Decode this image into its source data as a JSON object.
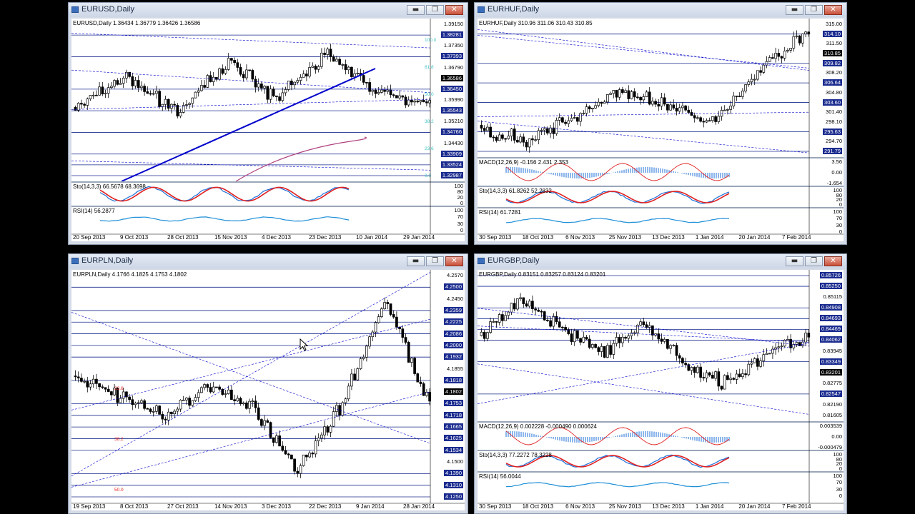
{
  "windows": [
    {
      "id": "w1",
      "title": "EURUSD,Daily",
      "info": "EURUSD,Daily  1.36434 1.36779 1.36426 1.36586",
      "prices": [
        {
          "v": "1.39150",
          "s": "plain"
        },
        {
          "v": "1.38281",
          "s": "box"
        },
        {
          "v": "1.37350",
          "s": "plain"
        },
        {
          "v": "1.37393",
          "s": "box"
        },
        {
          "v": "1.36790",
          "s": "plain"
        },
        {
          "v": "1.36586",
          "s": "cur"
        },
        {
          "v": "1.36450",
          "s": "box"
        },
        {
          "v": "1.35990",
          "s": "plain"
        },
        {
          "v": "1.35543",
          "s": "box"
        },
        {
          "v": "1.35210",
          "s": "plain"
        },
        {
          "v": "1.34766",
          "s": "box"
        },
        {
          "v": "1.34430",
          "s": "plain"
        },
        {
          "v": "1.33909",
          "s": "box"
        },
        {
          "v": "1.33524",
          "s": "box"
        },
        {
          "v": "1.32987",
          "s": "box"
        }
      ],
      "indicators": [
        {
          "label": "Sto(14,3,3) 66.5678 68.3698",
          "scale": [
            "100",
            "80",
            "20",
            "0"
          ]
        },
        {
          "label": "RSI(14) 56.2877",
          "scale": [
            "100",
            "70",
            "30",
            "0"
          ]
        }
      ],
      "dates": [
        "20 Sep 2013",
        "9 Oct 2013",
        "28 Oct 2013",
        "15 Nov 2013",
        "4 Dec 2013",
        "23 Dec 2013",
        "10 Jan 2014",
        "29 Jan 2014"
      ],
      "fibo": [
        "100.0",
        "61.8",
        "50.0",
        "38.2",
        "23.6",
        "0.0"
      ]
    },
    {
      "id": "w2",
      "title": "EURHUF,Daily",
      "info": "EURHUF,Daily  310.96 311.06 310.43 310.85",
      "prices": [
        {
          "v": "315.00",
          "s": "plain"
        },
        {
          "v": "314.10",
          "s": "box"
        },
        {
          "v": "311.50",
          "s": "plain"
        },
        {
          "v": "310.85",
          "s": "cur"
        },
        {
          "v": "309.82",
          "s": "box"
        },
        {
          "v": "308.20",
          "s": "plain"
        },
        {
          "v": "306.64",
          "s": "box"
        },
        {
          "v": "304.80",
          "s": "plain"
        },
        {
          "v": "303.60",
          "s": "box"
        },
        {
          "v": "301.40",
          "s": "plain"
        },
        {
          "v": "298.10",
          "s": "plain"
        },
        {
          "v": "295.63",
          "s": "box"
        },
        {
          "v": "294.70",
          "s": "plain"
        },
        {
          "v": "291.79",
          "s": "box"
        }
      ],
      "indicators": [
        {
          "label": "MACD(12,26,9) -0.156 2.431 2.353",
          "scale": [
            "3.56",
            "0.00",
            "-1.654"
          ]
        },
        {
          "label": "Sto(14,3,3) 61.8262 52.2832",
          "scale": [
            "100",
            "80",
            "20",
            "0"
          ]
        },
        {
          "label": "RSI(14) 61.7281",
          "scale": [
            "100",
            "70",
            "30",
            "0"
          ]
        }
      ],
      "dates": [
        "30 Sep 2013",
        "18 Oct 2013",
        "6 Nov 2013",
        "25 Nov 2013",
        "13 Dec 2013",
        "1 Jan 2014",
        "20 Jan 2014",
        "7 Feb 2014"
      ]
    },
    {
      "id": "w3",
      "title": "EURPLN,Daily",
      "info": "EURPLN,Daily  4.1766 4.1825 4.1753 4.1802",
      "prices": [
        {
          "v": "4.2570",
          "s": "plain"
        },
        {
          "v": "4.2500",
          "s": "box"
        },
        {
          "v": "4.2450",
          "s": "plain"
        },
        {
          "v": "4.2359",
          "s": "box"
        },
        {
          "v": "4.2225",
          "s": "box"
        },
        {
          "v": "4.2086",
          "s": "box"
        },
        {
          "v": "4.2000",
          "s": "box"
        },
        {
          "v": "4.1932",
          "s": "box"
        },
        {
          "v": "4.1855",
          "s": "plain"
        },
        {
          "v": "4.1818",
          "s": "box"
        },
        {
          "v": "4.1802",
          "s": "cur"
        },
        {
          "v": "4.1753",
          "s": "box"
        },
        {
          "v": "4.1718",
          "s": "box"
        },
        {
          "v": "4.1665",
          "s": "box"
        },
        {
          "v": "4.1625",
          "s": "box"
        },
        {
          "v": "4.1534",
          "s": "box"
        },
        {
          "v": "4.1500",
          "s": "plain"
        },
        {
          "v": "4.1390",
          "s": "box"
        },
        {
          "v": "4.1310",
          "s": "box"
        },
        {
          "v": "4.1250",
          "s": "box"
        }
      ],
      "indicators": [],
      "dates": [
        "19 Sep 2013",
        "8 Oct 2013",
        "27 Oct 2013",
        "14 Nov 2013",
        "3 Dec 2013",
        "22 Dec 2013",
        "9 Jan 2014",
        "28 Jan 2014"
      ],
      "fibo": [
        "23.6",
        "38.2",
        "50.0"
      ]
    },
    {
      "id": "w4",
      "title": "EURGBP,Daily",
      "info": "EURGBP,Daily  0.83151 0.83257 0.83124 0.83201",
      "prices": [
        {
          "v": "0.85726",
          "s": "box"
        },
        {
          "v": "0.85250",
          "s": "box"
        },
        {
          "v": "0.85115",
          "s": "plain"
        },
        {
          "v": "0.84908",
          "s": "box"
        },
        {
          "v": "0.84693",
          "s": "box"
        },
        {
          "v": "0.84469",
          "s": "box"
        },
        {
          "v": "0.84062",
          "s": "box"
        },
        {
          "v": "0.83945",
          "s": "plain"
        },
        {
          "v": "0.83349",
          "s": "box"
        },
        {
          "v": "0.83201",
          "s": "cur"
        },
        {
          "v": "0.82775",
          "s": "plain"
        },
        {
          "v": "0.82547",
          "s": "box"
        },
        {
          "v": "0.82190",
          "s": "plain"
        },
        {
          "v": "0.81605",
          "s": "plain"
        }
      ],
      "indicators": [
        {
          "label": "MACD(12,26,9) 0.002228 -0.000490 0.000624",
          "scale": [
            "0.003539",
            "0.00",
            "-0.000479"
          ]
        },
        {
          "label": "Sto(14,3,3) 77.2272 78.3228",
          "scale": [
            "100",
            "80",
            "20",
            "0"
          ]
        },
        {
          "label": "RSI(14) 56.0044",
          "scale": [
            "100",
            "70",
            "30",
            "0"
          ]
        }
      ],
      "dates": [
        "30 Sep 2013",
        "18 Oct 2013",
        "6 Nov 2013",
        "25 Nov 2013",
        "13 Dec 2013",
        "1 Jan 2014",
        "20 Jan 2014",
        "7 Feb 2014"
      ]
    }
  ],
  "buttons": {
    "minimize": "▬",
    "maximize": "❐",
    "close": "✕"
  },
  "colors": {
    "bg": "#000000",
    "chart_bg": "#ffffff",
    "candle": "#000000",
    "level_line": "#1b2c8f",
    "trend_line": "#0000cc",
    "sto_main": "#1e6fd8",
    "sto_signal": "#e02020",
    "rsi": "#1e8fd8",
    "ma": "#b04080",
    "fibo": "#40c0c0"
  }
}
